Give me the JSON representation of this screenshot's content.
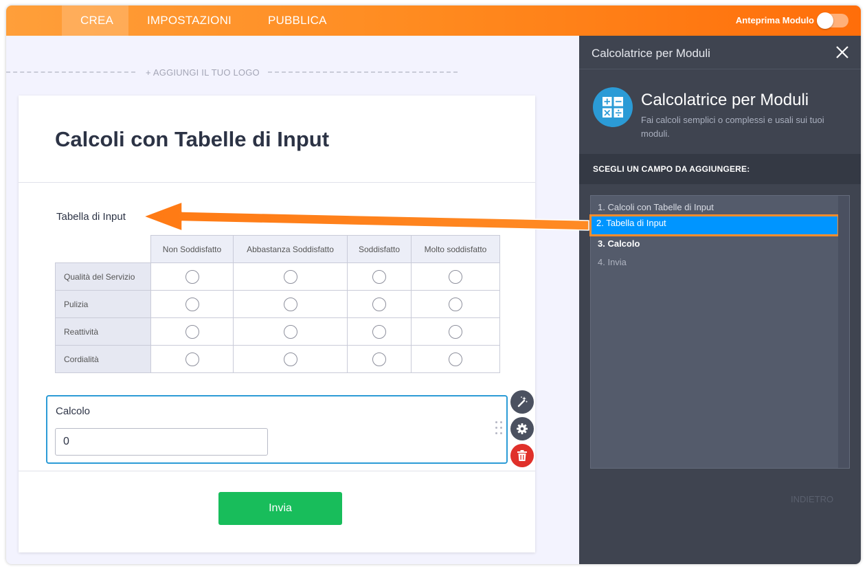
{
  "topbar": {
    "tabs": [
      {
        "label": "CREA"
      },
      {
        "label": "IMPOSTAZIONI"
      },
      {
        "label": "PUBBLICA"
      }
    ],
    "preview_label": "Anteprima Modulo"
  },
  "form": {
    "add_logo": "+ AGGIUNGI IL TUO LOGO",
    "title": "Calcoli con Tabelle di Input",
    "matrix": {
      "label": "Tabella di Input",
      "columns": [
        "Non Soddisfatto",
        "Abbastanza Soddisfatto",
        "Soddisfatto",
        "Molto soddisfatto"
      ],
      "rows": [
        "Qualità del Servizio",
        "Pulizia",
        "Reattività",
        "Cordialità"
      ]
    },
    "calc": {
      "label": "Calcolo",
      "value": "0"
    },
    "submit_label": "Invia"
  },
  "panel": {
    "title": "Calcolatrice per Moduli",
    "app_name": "Calcolatrice per Moduli",
    "app_desc": "Fai calcoli semplici o complessi e usali sui tuoi moduli.",
    "choose_label": "SCEGLI UN CAMPO DA AGGIUNGERE:",
    "items": [
      {
        "label": "1. Calcoli con Tabelle di Input"
      },
      {
        "label": "2. Tabella di Input"
      },
      {
        "label": "3. Calcolo"
      },
      {
        "label": "4. Invia"
      }
    ],
    "back_label": "INDIETRO"
  },
  "colors": {
    "accent_orange": "#ff8a1f",
    "selected_blue": "#0095ff",
    "submit_green": "#18bd5b",
    "calc_border": "#2b9bd6",
    "delete_red": "#e0302a"
  }
}
